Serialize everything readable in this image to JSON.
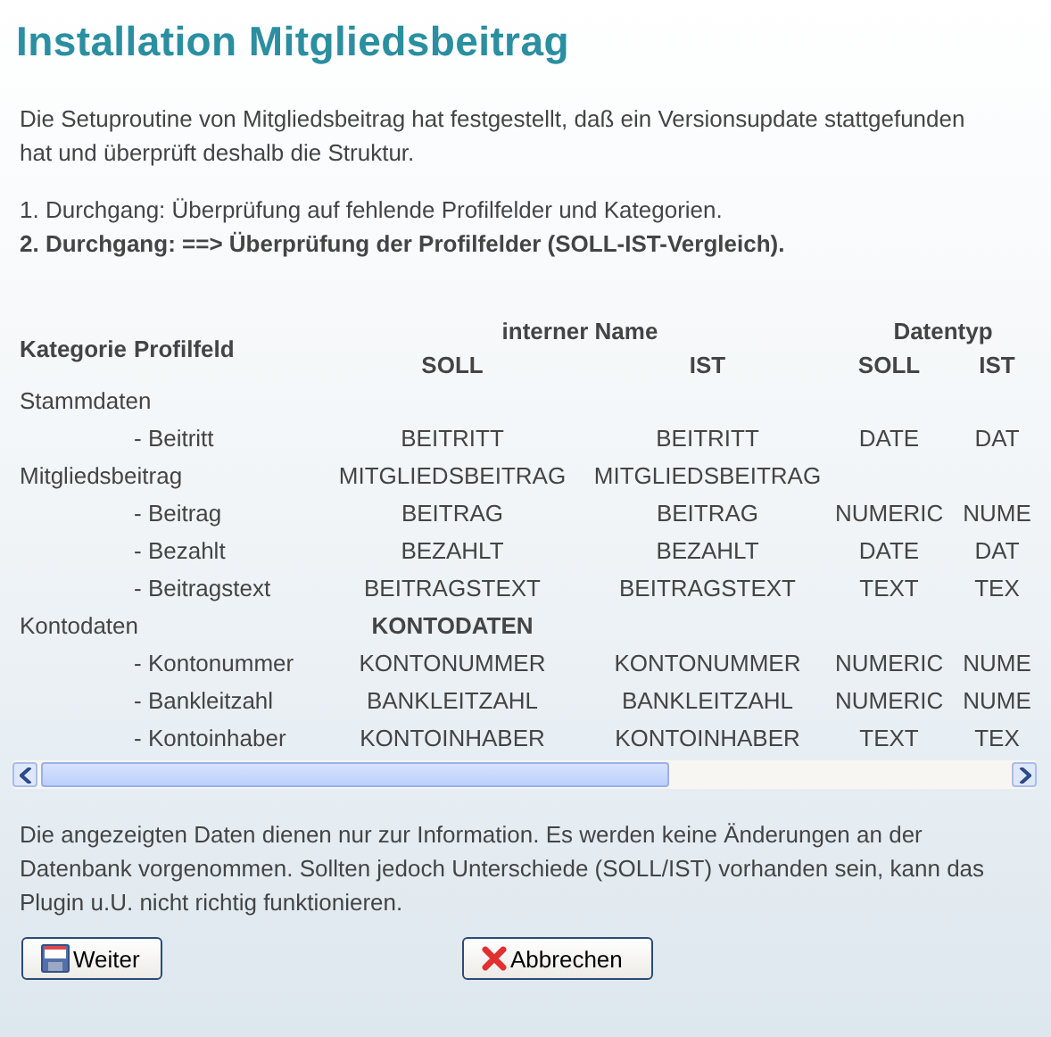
{
  "title": "Installation Mitgliedsbeitrag",
  "intro": "Die Setuproutine von Mitgliedsbeitrag hat festgestellt, daß ein Versionsupdate stattgefunden hat und überprüft deshalb die Struktur.",
  "steps": [
    {
      "text": "1. Durchgang: Überprüfung auf fehlende Profilfelder und Kategorien.",
      "current": false
    },
    {
      "text": "2. Durchgang: ==> Überprüfung der Profilfelder **(SOLL-IST-Vergleich)**.",
      "current": true
    }
  ],
  "table": {
    "headers": {
      "category": "Kategorie",
      "field": "Profilfeld",
      "internal": "interner Name",
      "datatype": "Datentyp",
      "internal_soll": "SOLL",
      "internal_ist": "IST",
      "type_soll": "SOLL",
      "type_ist": "IST"
    },
    "groups": [
      {
        "category": "Stammdaten",
        "fields": [
          {
            "name": "- Beitritt",
            "soll": "BEITRITT",
            "ist": "BEITRITT",
            "type_soll": "DATE",
            "type_ist": "DAT"
          }
        ]
      },
      {
        "category": "Mitgliedsbeitrag",
        "soll": "MITGLIEDSBEITRAG",
        "ist": "MITGLIEDSBEITRAG",
        "mismatch": false,
        "fields": [
          {
            "name": "- Beitrag",
            "soll": "BEITRAG",
            "ist": "BEITRAG",
            "type_soll": "NUMERIC",
            "type_ist": "NUME"
          },
          {
            "name": "- Bezahlt",
            "soll": "BEZAHLT",
            "ist": "BEZAHLT",
            "type_soll": "DATE",
            "type_ist": "DAT"
          },
          {
            "name": "- Beitragstext",
            "soll": "BEITRAGSTEXT",
            "ist": "BEITRAGSTEXT",
            "type_soll": "TEXT",
            "type_ist": "TEX"
          }
        ]
      },
      {
        "category": "Kontodaten",
        "soll": "KONTODATEN",
        "mismatch": true,
        "fields": [
          {
            "name": "- Kontonummer",
            "soll": "KONTONUMMER",
            "ist": "KONTONUMMER",
            "type_soll": "NUMERIC",
            "type_ist": "NUME"
          },
          {
            "name": "- Bankleitzahl",
            "soll": "BANKLEITZAHL",
            "ist": "BANKLEITZAHL",
            "type_soll": "NUMERIC",
            "type_ist": "NUME"
          },
          {
            "name": "- Kontoinhaber",
            "soll": "KONTOINHABER",
            "ist": "KONTOINHABER",
            "type_soll": "TEXT",
            "type_ist": "TEX"
          }
        ]
      }
    ]
  },
  "note": "Die angezeigten Daten dienen nur zur Information. Es werden keine Änderungen an der Datenbank vorgenommen. Sollten jedoch Unterschiede (SOLL/IST) vorhanden sein, kann das Plugin u.U. nicht richtig funktionieren.",
  "buttons": [
    {
      "label": "Weiter",
      "kind": "save"
    },
    {
      "label": "Abbrechen",
      "kind": "cancel"
    }
  ]
}
